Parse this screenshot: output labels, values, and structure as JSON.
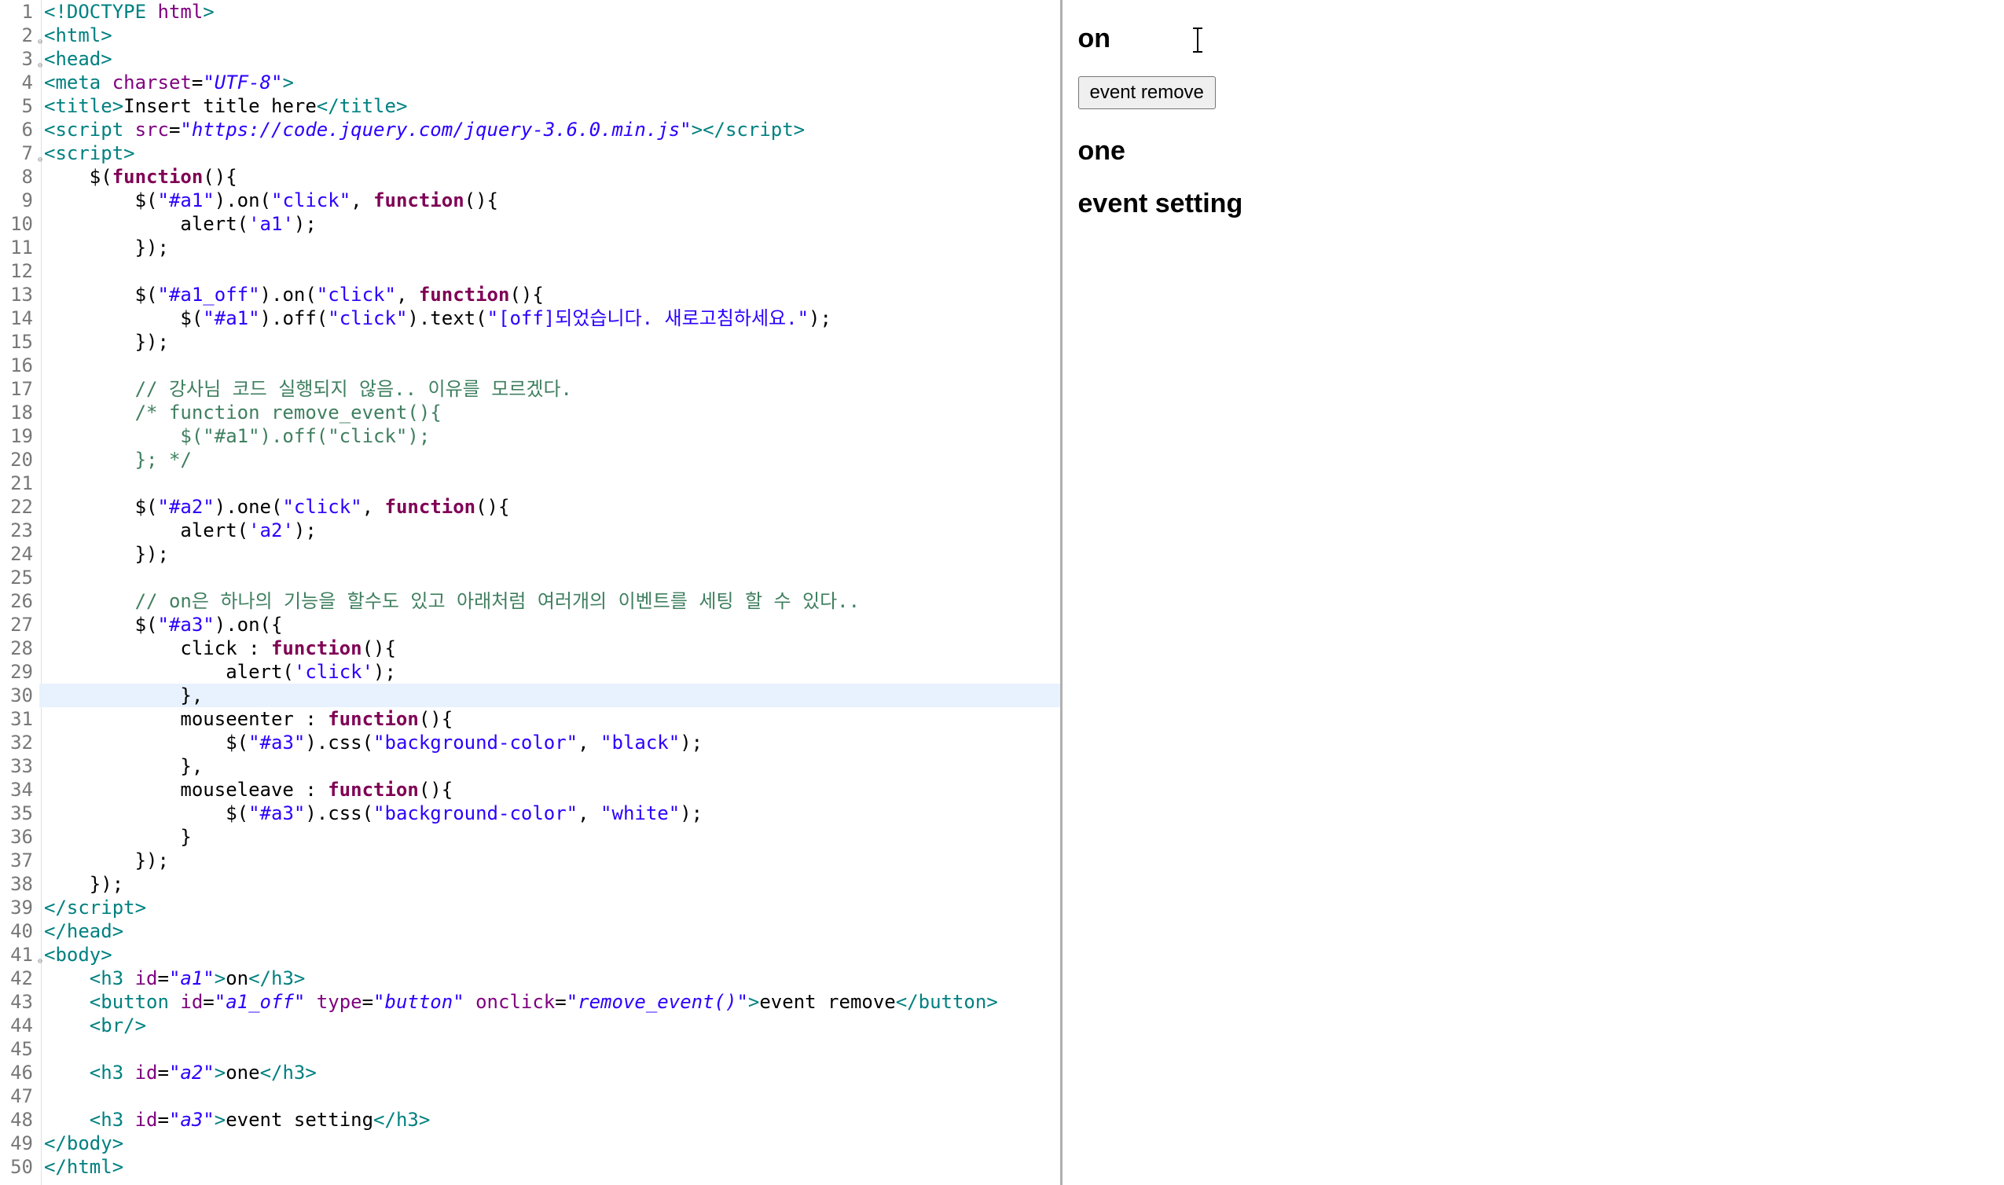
{
  "editor": {
    "highlighted_line": 30,
    "lines": [
      {
        "n": 1,
        "fold": false,
        "tokens": [
          [
            "c-tag",
            "<!DOCTYPE "
          ],
          [
            "c-attr",
            "html"
          ],
          [
            "c-tag",
            ">"
          ]
        ]
      },
      {
        "n": 2,
        "fold": true,
        "tokens": [
          [
            "c-tag",
            "<html>"
          ]
        ]
      },
      {
        "n": 3,
        "fold": true,
        "tokens": [
          [
            "c-tag",
            "<head>"
          ]
        ]
      },
      {
        "n": 4,
        "fold": false,
        "tokens": [
          [
            "c-tag",
            "<meta "
          ],
          [
            "c-attr",
            "charset"
          ],
          [
            "c-punc",
            "="
          ],
          [
            "c-str",
            "\"UTF-8\""
          ],
          [
            "c-tag",
            ">"
          ]
        ]
      },
      {
        "n": 5,
        "fold": false,
        "tokens": [
          [
            "c-tag",
            "<title>"
          ],
          [
            "c-text",
            "Insert title here"
          ],
          [
            "c-tag",
            "</title>"
          ]
        ]
      },
      {
        "n": 6,
        "fold": false,
        "tokens": [
          [
            "c-tag",
            "<script "
          ],
          [
            "c-attr",
            "src"
          ],
          [
            "c-punc",
            "="
          ],
          [
            "c-str",
            "\"https://code.jquery.com/jquery-3.6.0.min.js\""
          ],
          [
            "c-tag",
            ">"
          ],
          [
            "c-tag",
            "</script>"
          ]
        ]
      },
      {
        "n": 7,
        "fold": true,
        "tokens": [
          [
            "c-tag",
            "<script>"
          ]
        ]
      },
      {
        "n": 8,
        "fold": false,
        "tokens": [
          [
            "c-text",
            "    $("
          ],
          [
            "c-kw",
            "function"
          ],
          [
            "c-text",
            "(){"
          ]
        ]
      },
      {
        "n": 9,
        "fold": false,
        "tokens": [
          [
            "c-text",
            "        $("
          ],
          [
            "c-strn",
            "\"#a1\""
          ],
          [
            "c-text",
            ").on("
          ],
          [
            "c-strn",
            "\"click\""
          ],
          [
            "c-text",
            ", "
          ],
          [
            "c-kw",
            "function"
          ],
          [
            "c-text",
            "(){"
          ]
        ]
      },
      {
        "n": 10,
        "fold": false,
        "tokens": [
          [
            "c-text",
            "            alert("
          ],
          [
            "c-strn",
            "'a1'"
          ],
          [
            "c-text",
            ");"
          ]
        ]
      },
      {
        "n": 11,
        "fold": false,
        "tokens": [
          [
            "c-text",
            "        });"
          ]
        ]
      },
      {
        "n": 12,
        "fold": false,
        "tokens": [
          [
            "c-text",
            ""
          ]
        ]
      },
      {
        "n": 13,
        "fold": false,
        "tokens": [
          [
            "c-text",
            "        $("
          ],
          [
            "c-strn",
            "\"#a1_off\""
          ],
          [
            "c-text",
            ").on("
          ],
          [
            "c-strn",
            "\"click\""
          ],
          [
            "c-text",
            ", "
          ],
          [
            "c-kw",
            "function"
          ],
          [
            "c-text",
            "(){"
          ]
        ]
      },
      {
        "n": 14,
        "fold": false,
        "tokens": [
          [
            "c-text",
            "            $("
          ],
          [
            "c-strn",
            "\"#a1\""
          ],
          [
            "c-text",
            ").off("
          ],
          [
            "c-strn",
            "\"click\""
          ],
          [
            "c-text",
            ").text("
          ],
          [
            "c-strn",
            "\"[off]되었습니다. 새로고침하세요.\""
          ],
          [
            "c-text",
            ");"
          ]
        ]
      },
      {
        "n": 15,
        "fold": false,
        "tokens": [
          [
            "c-text",
            "        });"
          ]
        ]
      },
      {
        "n": 16,
        "fold": false,
        "tokens": [
          [
            "c-text",
            ""
          ]
        ]
      },
      {
        "n": 17,
        "fold": false,
        "tokens": [
          [
            "c-text",
            "        "
          ],
          [
            "c-comment",
            "// 강사님 코드 실행되지 않음.. 이유를 모르겠다."
          ]
        ]
      },
      {
        "n": 18,
        "fold": false,
        "tokens": [
          [
            "c-text",
            "        "
          ],
          [
            "c-comment",
            "/* function remove_event(){"
          ]
        ]
      },
      {
        "n": 19,
        "fold": false,
        "tokens": [
          [
            "c-comment",
            "            $(\"#a1\").off(\"click\");"
          ]
        ]
      },
      {
        "n": 20,
        "fold": false,
        "tokens": [
          [
            "c-comment",
            "        }; */"
          ]
        ]
      },
      {
        "n": 21,
        "fold": false,
        "tokens": [
          [
            "c-text",
            ""
          ]
        ]
      },
      {
        "n": 22,
        "fold": false,
        "tokens": [
          [
            "c-text",
            "        $("
          ],
          [
            "c-strn",
            "\"#a2\""
          ],
          [
            "c-text",
            ").one("
          ],
          [
            "c-strn",
            "\"click\""
          ],
          [
            "c-text",
            ", "
          ],
          [
            "c-kw",
            "function"
          ],
          [
            "c-text",
            "(){"
          ]
        ]
      },
      {
        "n": 23,
        "fold": false,
        "tokens": [
          [
            "c-text",
            "            alert("
          ],
          [
            "c-strn",
            "'a2'"
          ],
          [
            "c-text",
            ");"
          ]
        ]
      },
      {
        "n": 24,
        "fold": false,
        "tokens": [
          [
            "c-text",
            "        });"
          ]
        ]
      },
      {
        "n": 25,
        "fold": false,
        "tokens": [
          [
            "c-text",
            ""
          ]
        ]
      },
      {
        "n": 26,
        "fold": false,
        "tokens": [
          [
            "c-text",
            "        "
          ],
          [
            "c-comment",
            "// on은 하나의 기능을 할수도 있고 아래처럼 여러개의 이벤트를 세팅 할 수 있다.."
          ]
        ]
      },
      {
        "n": 27,
        "fold": false,
        "tokens": [
          [
            "c-text",
            "        $("
          ],
          [
            "c-strn",
            "\"#a3\""
          ],
          [
            "c-text",
            ").on({"
          ]
        ]
      },
      {
        "n": 28,
        "fold": false,
        "tokens": [
          [
            "c-text",
            "            click : "
          ],
          [
            "c-kw",
            "function"
          ],
          [
            "c-text",
            "(){"
          ]
        ]
      },
      {
        "n": 29,
        "fold": false,
        "tokens": [
          [
            "c-text",
            "                alert("
          ],
          [
            "c-strn",
            "'click'"
          ],
          [
            "c-text",
            ");"
          ]
        ]
      },
      {
        "n": 30,
        "fold": false,
        "tokens": [
          [
            "c-text",
            "            },"
          ]
        ]
      },
      {
        "n": 31,
        "fold": false,
        "tokens": [
          [
            "c-text",
            "            mouseenter : "
          ],
          [
            "c-kw",
            "function"
          ],
          [
            "c-text",
            "(){"
          ]
        ]
      },
      {
        "n": 32,
        "fold": false,
        "tokens": [
          [
            "c-text",
            "                $("
          ],
          [
            "c-strn",
            "\"#a3\""
          ],
          [
            "c-text",
            ").css("
          ],
          [
            "c-strn",
            "\"background-color\""
          ],
          [
            "c-text",
            ", "
          ],
          [
            "c-strn",
            "\"black\""
          ],
          [
            "c-text",
            ");"
          ]
        ]
      },
      {
        "n": 33,
        "fold": false,
        "tokens": [
          [
            "c-text",
            "            },"
          ]
        ]
      },
      {
        "n": 34,
        "fold": false,
        "tokens": [
          [
            "c-text",
            "            mouseleave : "
          ],
          [
            "c-kw",
            "function"
          ],
          [
            "c-text",
            "(){"
          ]
        ]
      },
      {
        "n": 35,
        "fold": false,
        "tokens": [
          [
            "c-text",
            "                $("
          ],
          [
            "c-strn",
            "\"#a3\""
          ],
          [
            "c-text",
            ").css("
          ],
          [
            "c-strn",
            "\"background-color\""
          ],
          [
            "c-text",
            ", "
          ],
          [
            "c-strn",
            "\"white\""
          ],
          [
            "c-text",
            ");"
          ]
        ]
      },
      {
        "n": 36,
        "fold": false,
        "tokens": [
          [
            "c-text",
            "            }"
          ]
        ]
      },
      {
        "n": 37,
        "fold": false,
        "tokens": [
          [
            "c-text",
            "        });"
          ]
        ]
      },
      {
        "n": 38,
        "fold": false,
        "tokens": [
          [
            "c-text",
            "    });"
          ]
        ]
      },
      {
        "n": 39,
        "fold": false,
        "tokens": [
          [
            "c-tag",
            "</script>"
          ]
        ]
      },
      {
        "n": 40,
        "fold": false,
        "tokens": [
          [
            "c-tag",
            "</head>"
          ]
        ]
      },
      {
        "n": 41,
        "fold": true,
        "tokens": [
          [
            "c-tag",
            "<body>"
          ]
        ]
      },
      {
        "n": 42,
        "fold": false,
        "tokens": [
          [
            "c-text",
            "    "
          ],
          [
            "c-tag",
            "<h3 "
          ],
          [
            "c-attr",
            "id"
          ],
          [
            "c-punc",
            "="
          ],
          [
            "c-str",
            "\"a1\""
          ],
          [
            "c-tag",
            ">"
          ],
          [
            "c-text",
            "on"
          ],
          [
            "c-tag",
            "</h3>"
          ]
        ]
      },
      {
        "n": 43,
        "fold": false,
        "tokens": [
          [
            "c-text",
            "    "
          ],
          [
            "c-tag",
            "<button "
          ],
          [
            "c-attr",
            "id"
          ],
          [
            "c-punc",
            "="
          ],
          [
            "c-str",
            "\"a1_off\""
          ],
          [
            "c-tag",
            " "
          ],
          [
            "c-attr",
            "type"
          ],
          [
            "c-punc",
            "="
          ],
          [
            "c-str",
            "\"button\""
          ],
          [
            "c-tag",
            " "
          ],
          [
            "c-attr",
            "onclick"
          ],
          [
            "c-punc",
            "="
          ],
          [
            "c-str",
            "\"remove_event()\""
          ],
          [
            "c-tag",
            ">"
          ],
          [
            "c-text",
            "event remove"
          ],
          [
            "c-tag",
            "</button>"
          ]
        ]
      },
      {
        "n": 44,
        "fold": false,
        "tokens": [
          [
            "c-text",
            "    "
          ],
          [
            "c-tag",
            "<br/>"
          ]
        ]
      },
      {
        "n": 45,
        "fold": false,
        "tokens": [
          [
            "c-text",
            ""
          ]
        ]
      },
      {
        "n": 46,
        "fold": false,
        "tokens": [
          [
            "c-text",
            "    "
          ],
          [
            "c-tag",
            "<h3 "
          ],
          [
            "c-attr",
            "id"
          ],
          [
            "c-punc",
            "="
          ],
          [
            "c-str",
            "\"a2\""
          ],
          [
            "c-tag",
            ">"
          ],
          [
            "c-text",
            "one"
          ],
          [
            "c-tag",
            "</h3>"
          ]
        ]
      },
      {
        "n": 47,
        "fold": false,
        "tokens": [
          [
            "c-text",
            ""
          ]
        ]
      },
      {
        "n": 48,
        "fold": false,
        "tokens": [
          [
            "c-text",
            "    "
          ],
          [
            "c-tag",
            "<h3 "
          ],
          [
            "c-attr",
            "id"
          ],
          [
            "c-punc",
            "="
          ],
          [
            "c-str",
            "\"a3\""
          ],
          [
            "c-tag",
            ">"
          ],
          [
            "c-text",
            "event setting"
          ],
          [
            "c-tag",
            "</h3>"
          ]
        ]
      },
      {
        "n": 49,
        "fold": false,
        "tokens": [
          [
            "c-tag",
            "</body>"
          ]
        ]
      },
      {
        "n": 50,
        "fold": false,
        "tokens": [
          [
            "c-tag",
            "</html>"
          ]
        ]
      }
    ]
  },
  "preview": {
    "h3_a1": "on",
    "button_a1_off": "event remove",
    "h3_a2": "one",
    "h3_a3": "event setting"
  }
}
